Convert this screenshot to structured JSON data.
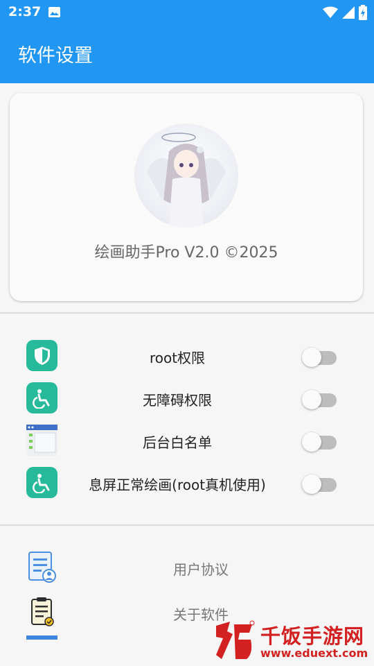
{
  "status_bar": {
    "time": "2:37",
    "icons": [
      "image-icon",
      "wifi-icon",
      "signal-icon",
      "battery-charging-icon"
    ]
  },
  "app_bar": {
    "title": "软件设置"
  },
  "profile": {
    "version_text": "绘画助手Pro V2.0 ©2025"
  },
  "settings": [
    {
      "label": "root权限",
      "icon": "shield-icon",
      "enabled": false
    },
    {
      "label": "无障碍权限",
      "icon": "accessibility-icon",
      "enabled": false
    },
    {
      "label": "后台白名单",
      "icon": "app-window-icon",
      "enabled": false
    },
    {
      "label": "息屏正常绘画(root真机使用)",
      "icon": "accessibility-icon",
      "enabled": false
    }
  ],
  "links": [
    {
      "label": "用户协议",
      "icon": "user-agreement-icon"
    },
    {
      "label": "关于软件",
      "icon": "clipboard-icon"
    }
  ],
  "watermark": {
    "name": "千饭手游网",
    "url": "www.eduext.com"
  },
  "colors": {
    "primary": "#2196f3",
    "icon_teal": "#26b99a",
    "watermark_red": "#d32020"
  }
}
